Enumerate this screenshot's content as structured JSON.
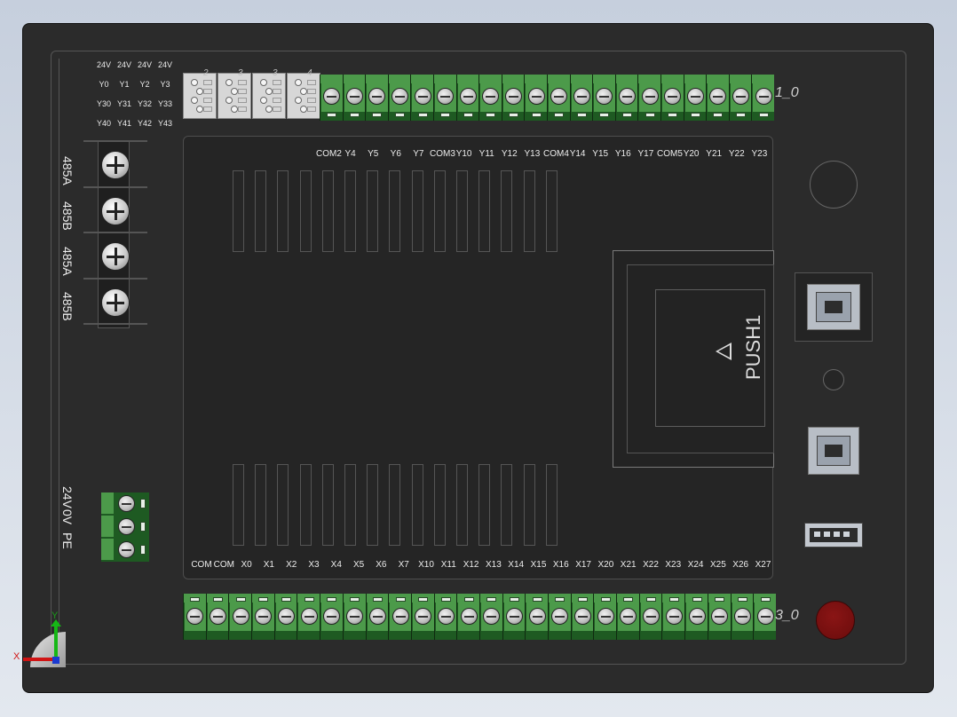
{
  "top_io_rows": [
    [
      "24V",
      "24V",
      "24V",
      "24V"
    ],
    [
      "Y0",
      "Y1",
      "Y2",
      "Y3"
    ],
    [
      "Y30",
      "Y31",
      "Y32",
      "Y33"
    ],
    [
      "Y40",
      "Y41",
      "Y42",
      "Y43"
    ]
  ],
  "output_labels": [
    "COM2",
    "Y4",
    "Y5",
    "Y6",
    "Y7",
    "COM3",
    "Y10",
    "Y11",
    "Y12",
    "Y13",
    "COM4",
    "Y14",
    "Y15",
    "Y16",
    "Y17",
    "COM5",
    "Y20",
    "Y21",
    "Y22",
    "Y23"
  ],
  "input_labels": [
    "COM",
    "COM",
    "X0",
    "X1",
    "X2",
    "X3",
    "X4",
    "X5",
    "X6",
    "X7",
    "X10",
    "X11",
    "X12",
    "X13",
    "X14",
    "X15",
    "X16",
    "X17",
    "X20",
    "X21",
    "X22",
    "X23",
    "X24",
    "X25",
    "X26",
    "X27"
  ],
  "dip_numbers": [
    "2",
    "3",
    "3",
    "4"
  ],
  "top_terminal_marker": "1_0",
  "bottom_terminal_marker": "3_0",
  "rs485_labels": [
    "485A",
    "485B",
    "485A",
    "485B"
  ],
  "power_labels": [
    "24V",
    "0V",
    "PE"
  ],
  "card_slot_label": "PUSH1",
  "triad": {
    "x_label": "X",
    "y_label": "Y"
  },
  "colors": {
    "housing": "#2b2b2b",
    "terminal_green": "#4c9a4a",
    "terminal_dark": "#1e5a22",
    "led_red": "#7a0f0f"
  }
}
